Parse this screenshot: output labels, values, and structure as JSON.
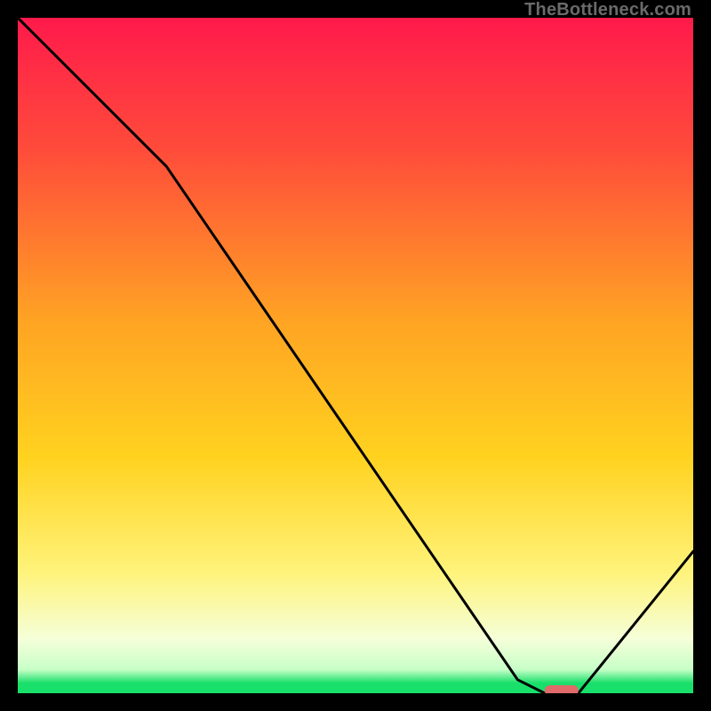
{
  "watermark": "TheBottleneck.com",
  "colors": {
    "top": "#ff1a4b",
    "mid1": "#ff7a33",
    "mid2": "#ffd21f",
    "mid3": "#ffef7a",
    "low_pale": "#f3ffd6",
    "green": "#18e06a",
    "curve": "#000000",
    "marker": "#e16a6a",
    "frame": "#000000"
  },
  "chart_data": {
    "type": "line",
    "title": "",
    "xlabel": "",
    "ylabel": "",
    "xlim": [
      0,
      100
    ],
    "ylim": [
      0,
      100
    ],
    "series": [
      {
        "name": "bottleneck-curve",
        "x": [
          0,
          22,
          74,
          78,
          83,
          100
        ],
        "values": [
          100,
          78,
          2,
          0,
          0,
          21
        ]
      }
    ],
    "marker": {
      "x_start": 78,
      "x_end": 83,
      "y": 0
    },
    "gradient_stops": [
      {
        "pos": 0.0,
        "color": "#ff1a4b"
      },
      {
        "pos": 0.2,
        "color": "#ff4d3a"
      },
      {
        "pos": 0.45,
        "color": "#ffa423"
      },
      {
        "pos": 0.65,
        "color": "#ffd21f"
      },
      {
        "pos": 0.82,
        "color": "#fff37a"
      },
      {
        "pos": 0.92,
        "color": "#f5ffd9"
      },
      {
        "pos": 0.965,
        "color": "#c7ffc7"
      },
      {
        "pos": 0.985,
        "color": "#18e06a"
      },
      {
        "pos": 1.0,
        "color": "#18e06a"
      }
    ]
  }
}
